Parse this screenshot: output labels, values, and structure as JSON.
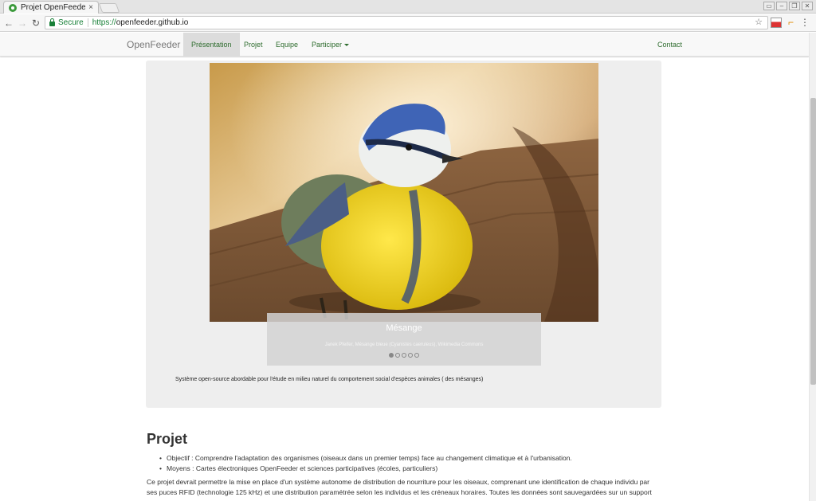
{
  "browser": {
    "tab_title": "Projet OpenFeeder",
    "tab_close": "×",
    "secure_label": "Secure",
    "url_scheme": "https://",
    "url_host": "openfeeder.github.io",
    "bookmark_icon": "star-icon",
    "window_buttons": [
      "▭",
      "–",
      "❐",
      "✕"
    ]
  },
  "navbar": {
    "brand": "OpenFeeder",
    "items": [
      {
        "label": "Présentation",
        "active": true
      },
      {
        "label": "Projet"
      },
      {
        "label": "Equipe"
      },
      {
        "label": "Participer"
      }
    ],
    "contact": "Contact"
  },
  "carousel": {
    "caption_title": "Mésange",
    "caption_sub": "Janek Pfeifer, Mésange bleue (Cyanistes caeruleus), Wikimedia Commons",
    "slides": 5,
    "active_index": 0
  },
  "jumbotron_text": "Système open-source abordable pour l'étude en milieu naturel du comportement social d'espèces animales ( des mésanges)",
  "projet": {
    "title": "Projet",
    "bullets": [
      "Objectif : Comprendre l'adaptation des organismes (oiseaux dans un premier temps) face au changement climatique et à l'urbanisation.",
      "Moyens : Cartes électroniques OpenFeeder et sciences participatives (écoles, particuliers)"
    ],
    "paragraph": "Ce projet devrait permettre la mise en place d'un système autonome de distribution de nourriture pour les oiseaux, comprenant une identification de chaque individu par ses puces RFID (technologie 125 kHz) et une distribution paramétrée selon les individus et les créneaux horaires. Toutes les données sont sauvegardées sur un support"
  },
  "colors": {
    "link": "#2e6c2e",
    "secure": "#188038",
    "jumbotron_bg": "#eeeeee"
  }
}
